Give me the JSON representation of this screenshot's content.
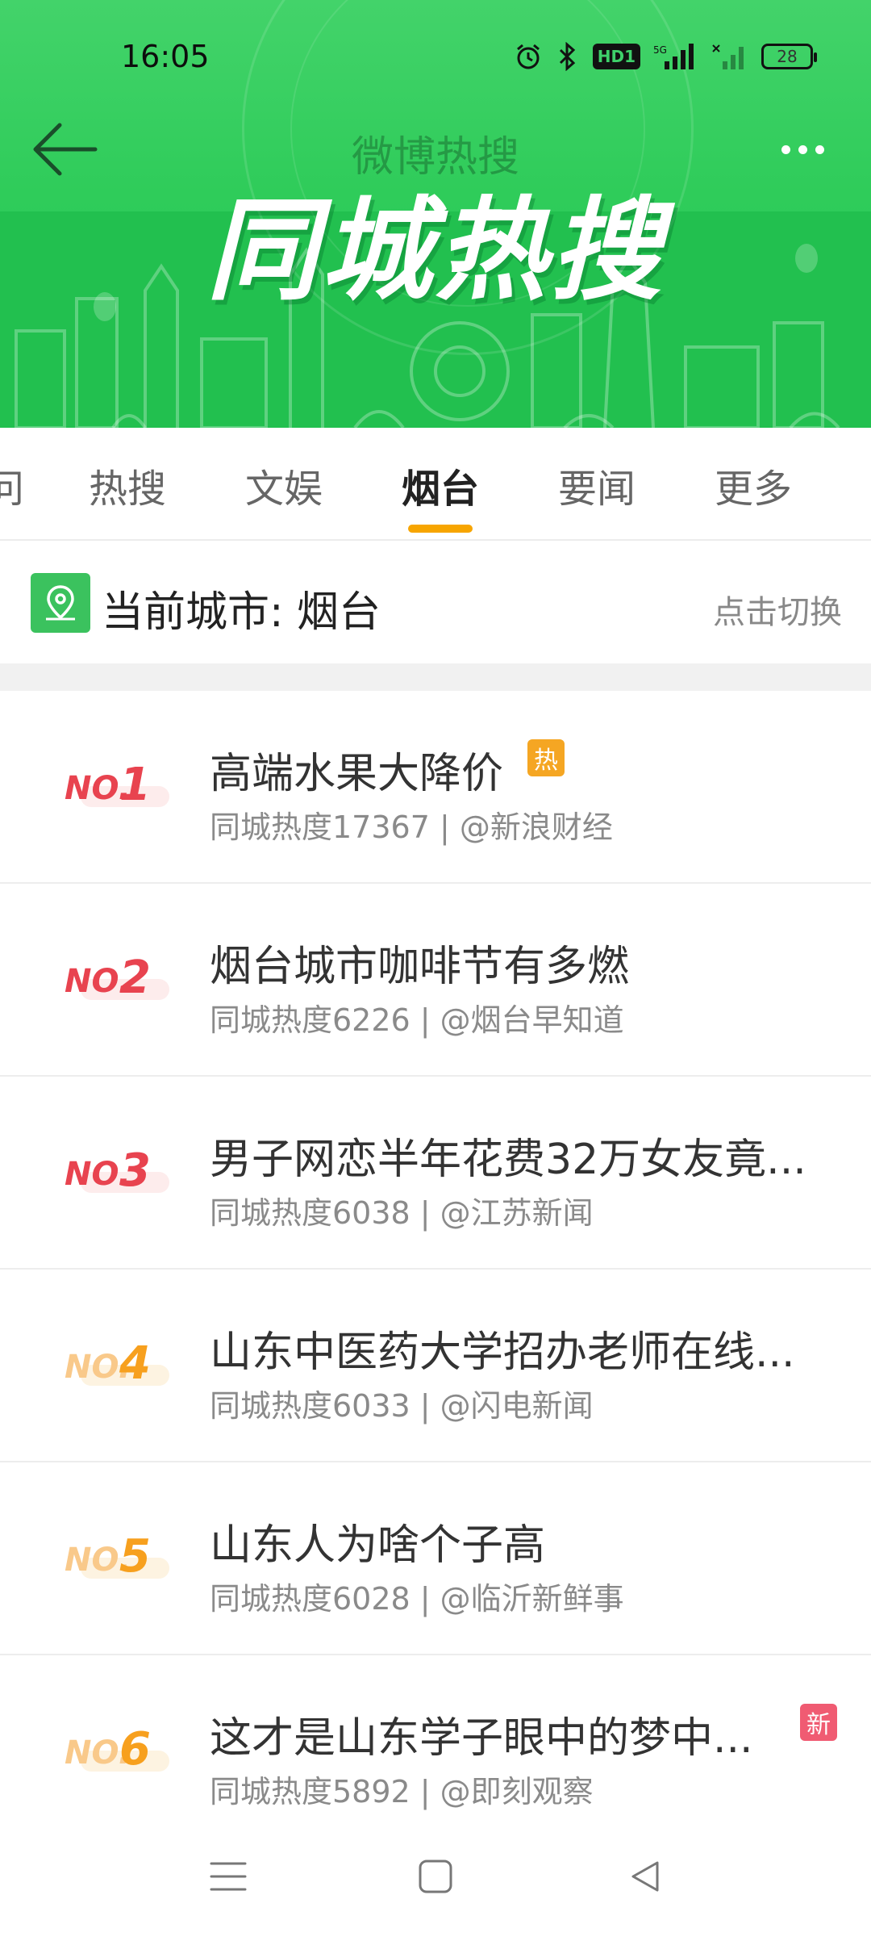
{
  "status_bar": {
    "time": "16:05",
    "hd_label": "HD1",
    "network": "5G",
    "battery": "28"
  },
  "header": {
    "nav_title": "微博热搜",
    "banner_title": "同城热搜"
  },
  "tabs": [
    {
      "label": "问",
      "active": false
    },
    {
      "label": "热搜",
      "active": false
    },
    {
      "label": "文娱",
      "active": false
    },
    {
      "label": "烟台",
      "active": true
    },
    {
      "label": "要闻",
      "active": false
    },
    {
      "label": "更多",
      "active": false
    }
  ],
  "city": {
    "label": "当前城市: 烟台",
    "switch_label": "点击切换"
  },
  "items": [
    {
      "rank_prefix": "NO.",
      "rank": "1",
      "title": "高端水果大降价",
      "meta": "同城热度17367 | @新浪财经",
      "badge": "热"
    },
    {
      "rank_prefix": "NO.",
      "rank": "2",
      "title": "烟台城市咖啡节有多燃",
      "meta": "同城热度6226 | @烟台早知道",
      "badge": ""
    },
    {
      "rank_prefix": "NO.",
      "rank": "3",
      "title": "男子网恋半年花费32万女友竟...",
      "meta": "同城热度6038 | @江苏新闻",
      "badge": ""
    },
    {
      "rank_prefix": "NO.",
      "rank": "4",
      "title": "山东中医药大学招办老师在线...",
      "meta": "同城热度6033 | @闪电新闻",
      "badge": ""
    },
    {
      "rank_prefix": "NO.",
      "rank": "5",
      "title": "山东人为啥个子高",
      "meta": "同城热度6028 | @临沂新鲜事",
      "badge": ""
    },
    {
      "rank_prefix": "NO.",
      "rank": "6",
      "title": "这才是山东学子眼中的梦中...",
      "meta": "同城热度5892 | @即刻观察",
      "badge": "新"
    }
  ],
  "colors": {
    "banner_green": "#2fcc5a",
    "tab_underline": "#f7a500",
    "rank_red": "#e8434f",
    "rank_orange": "#f7a01e",
    "badge_hot": "#f5a623",
    "badge_new": "#f05b72"
  },
  "icons": {
    "back": "back-arrow-icon",
    "more": "more-dots-icon",
    "city": "location-pin-icon",
    "alarm": "alarm-icon",
    "bluetooth": "bluetooth-icon",
    "signal": "signal-icon",
    "nav_menu": "menu-icon",
    "nav_home": "home-square-icon",
    "nav_back": "back-triangle-icon"
  }
}
